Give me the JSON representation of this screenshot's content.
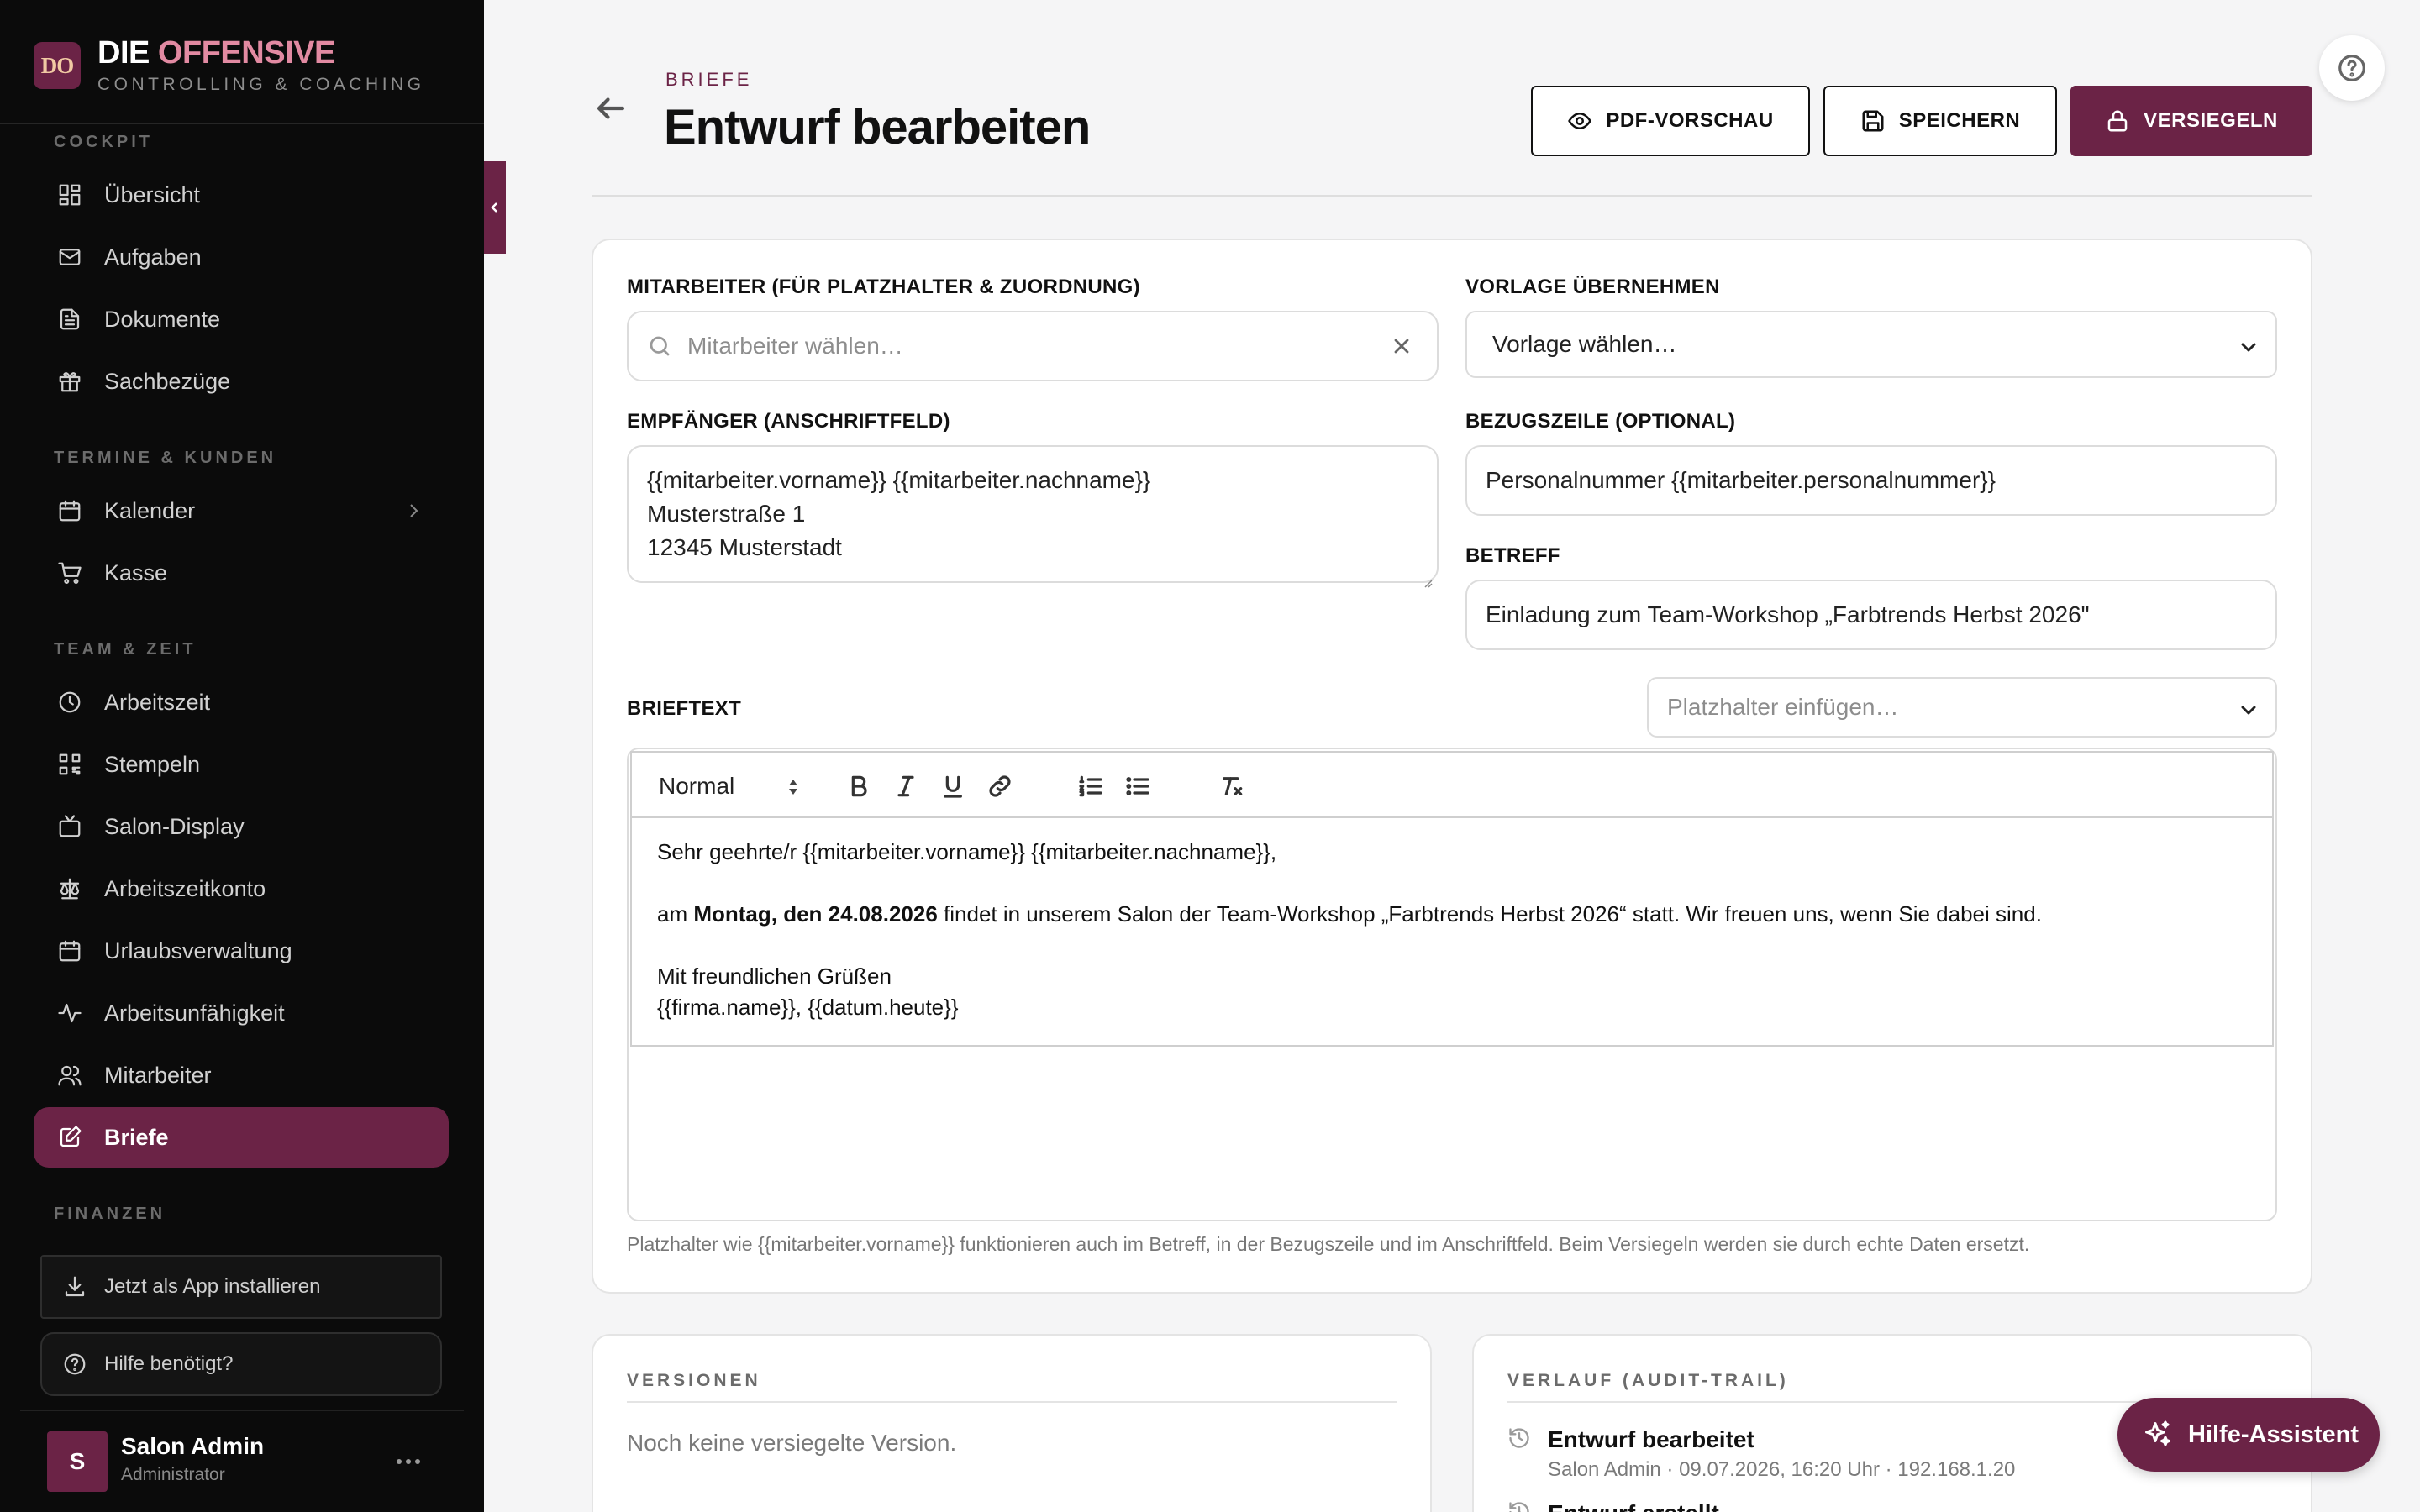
{
  "brand": {
    "logo_text": "DO",
    "title_part1": "DIE",
    "title_part2": "OFFENSIVE",
    "subtitle": "CONTROLLING & COACHING"
  },
  "sidebar": {
    "section_cockpit": "COCKPIT",
    "section_termine": "TERMINE & KUNDEN",
    "section_team": "TEAM & ZEIT",
    "section_finanzen": "FINANZEN",
    "items": [
      {
        "label": "Übersicht",
        "icon": "dashboard-icon"
      },
      {
        "label": "Aufgaben",
        "icon": "mail-icon"
      },
      {
        "label": "Dokumente",
        "icon": "document-icon"
      },
      {
        "label": "Sachbezüge",
        "icon": "gift-icon"
      },
      {
        "label": "Kalender",
        "icon": "calendar-icon"
      },
      {
        "label": "Kasse",
        "icon": "cart-icon"
      },
      {
        "label": "Arbeitszeit",
        "icon": "clock-icon"
      },
      {
        "label": "Stempeln",
        "icon": "qr-icon"
      },
      {
        "label": "Salon-Display",
        "icon": "tv-icon"
      },
      {
        "label": "Arbeitszeitkonto",
        "icon": "scale-icon"
      },
      {
        "label": "Urlaubsverwaltung",
        "icon": "calendar-icon"
      },
      {
        "label": "Arbeitsunfähigkeit",
        "icon": "activity-icon"
      },
      {
        "label": "Mitarbeiter",
        "icon": "users-icon"
      },
      {
        "label": "Briefe",
        "icon": "edit-icon",
        "active": true
      }
    ],
    "install_label": "Jetzt als App installieren",
    "help_label": "Hilfe benötigt?",
    "user_initial": "S",
    "user_name": "Salon Admin",
    "user_role": "Administrator"
  },
  "header": {
    "eyebrow": "BRIEFE",
    "title": "Entwurf bearbeiten",
    "btn_preview": "PDF-VORSCHAU",
    "btn_save": "SPEICHERN",
    "btn_seal": "VERSIEGELN"
  },
  "form": {
    "employee_label": "MITARBEITER (FÜR PLATZHALTER & ZUORDNUNG)",
    "employee_placeholder": "Mitarbeiter wählen…",
    "template_label": "VORLAGE ÜBERNEHMEN",
    "template_value": "Vorlage wählen…",
    "recipient_label": "EMPFÄNGER (ANSCHRIFTFELD)",
    "recipient_lines": [
      "{{mitarbeiter.vorname}} {{mitarbeiter.nachname}}",
      "Musterstraße 1",
      "12345 Musterstadt"
    ],
    "reference_label": "BEZUGSZEILE (OPTIONAL)",
    "reference_value": "Personalnummer {{mitarbeiter.personalnummer}}",
    "subject_label": "BETREFF",
    "subject_value": "Einladung zum Team-Workshop „Farbtrends Herbst 2026\"",
    "body_label": "BRIEFTEXT",
    "placeholder_select": "Platzhalter einfügen…",
    "toolbar_format": "Normal",
    "body": {
      "greeting": "Sehr geehrte/r {{mitarbeiter.vorname}} {{mitarbeiter.nachname}},",
      "line_prefix": "am ",
      "line_bold": "Montag, den 24.08.2026",
      "line_suffix": " findet in unserem Salon der Team-Workshop „Farbtrends Herbst 2026“ statt. Wir freuen uns, wenn Sie dabei sind.",
      "closing": "Mit freundlichen Grüßen",
      "signature": "{{firma.name}}, {{datum.heute}}"
    },
    "hint": "Platzhalter wie {{mitarbeiter.vorname}} funktionieren auch im Betreff, in der Bezugszeile und im Anschriftfeld. Beim Versiegeln werden sie durch echte Daten ersetzt."
  },
  "versions": {
    "label": "VERSIONEN",
    "empty": "Noch keine versiegelte Version."
  },
  "audit": {
    "label": "VERLAUF (AUDIT-TRAIL)",
    "entries": [
      {
        "title": "Entwurf bearbeitet",
        "meta": "Salon Admin · 09.07.2026, 16:20 Uhr · 192.168.1.20"
      },
      {
        "title": "Entwurf erstellt"
      }
    ]
  },
  "assistant_label": "Hilfe-Assistent",
  "colors": {
    "brand": "#6b2346",
    "sidebar": "#0b0b0b",
    "logo_accent": "#e28aa2"
  }
}
